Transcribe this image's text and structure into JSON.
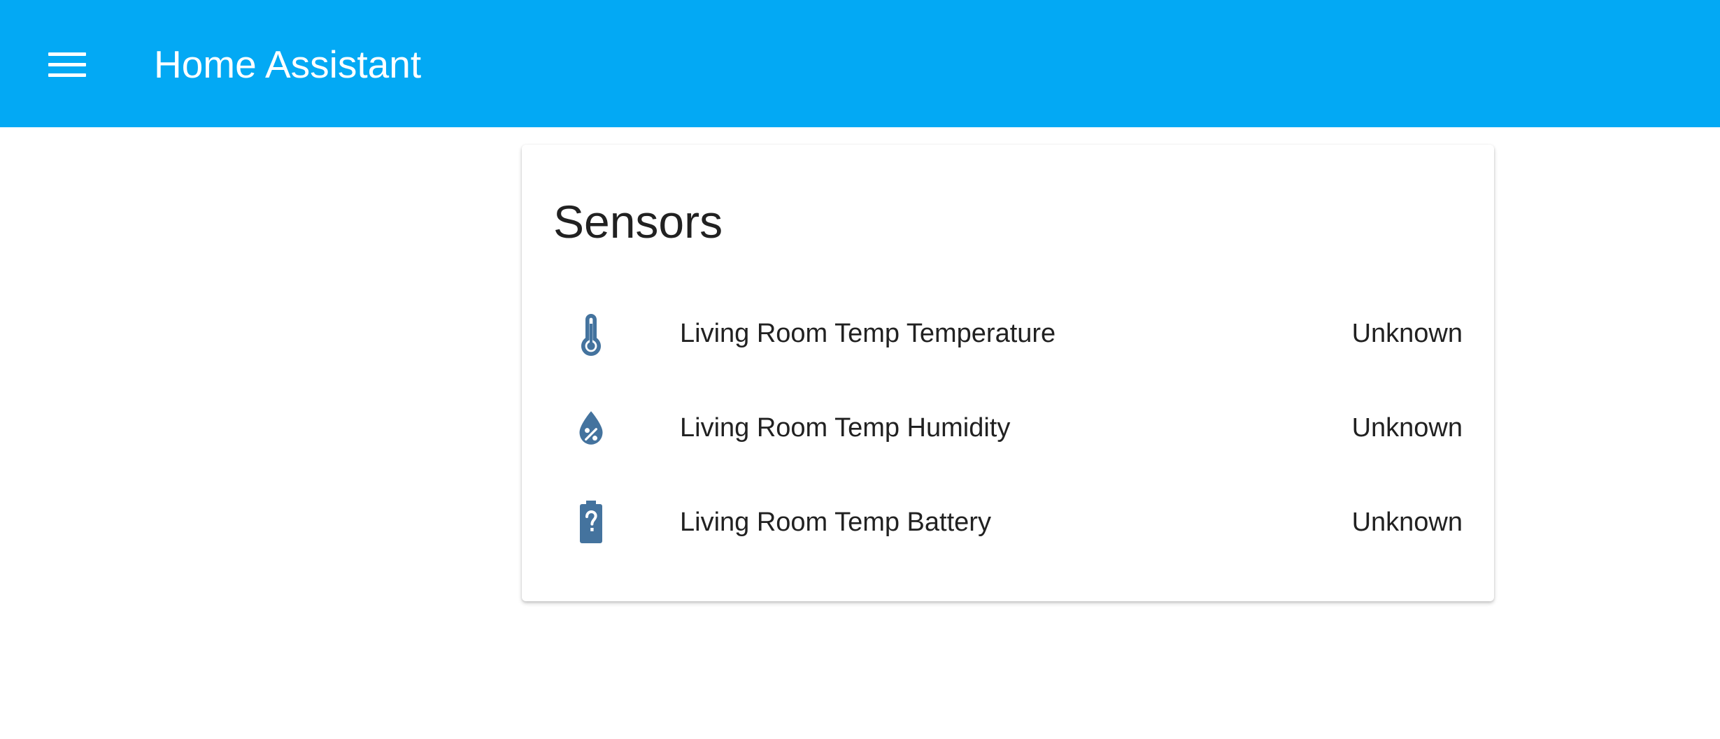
{
  "header": {
    "app_title": "Home Assistant",
    "menu_icon": "hamburger-menu-icon",
    "background_color": "#03a9f4"
  },
  "card": {
    "title": "Sensors",
    "icon_color": "#44739e",
    "entities": [
      {
        "name": "Living Room Temp Temperature",
        "state": "Unknown",
        "icon": "thermometer-icon"
      },
      {
        "name": "Living Room Temp Humidity",
        "state": "Unknown",
        "icon": "water-percent-icon"
      },
      {
        "name": "Living Room Temp Battery",
        "state": "Unknown",
        "icon": "battery-unknown-icon"
      }
    ]
  }
}
